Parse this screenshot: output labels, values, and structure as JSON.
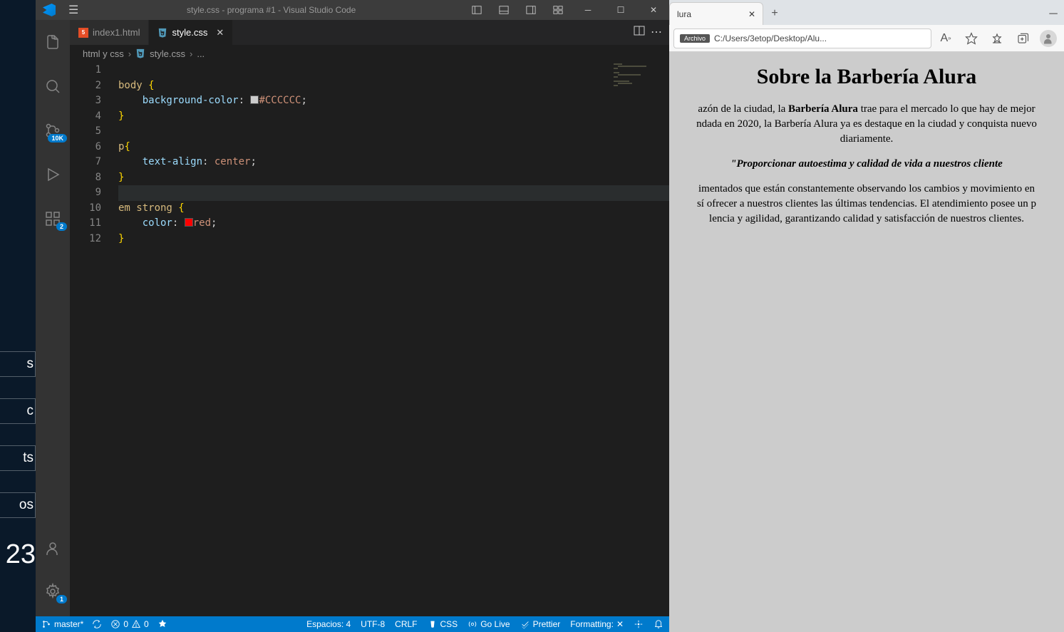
{
  "desktop": {
    "folders": [
      "s",
      "c",
      "ts",
      "os"
    ],
    "clock": "23"
  },
  "vscode": {
    "title": "style.css - programa #1 - Visual Studio Code",
    "tabs": [
      {
        "name": "index1.html",
        "icon": "html"
      },
      {
        "name": "style.css",
        "icon": "css",
        "active": true
      }
    ],
    "breadcrumb": {
      "folder": "html y css",
      "file": "style.css",
      "more": "..."
    },
    "activityBadges": {
      "scm": "10K",
      "extensions": "2",
      "settings": "1"
    },
    "code": {
      "lineCount": 12,
      "lines": [
        {
          "indent": "",
          "parts": [
            {
              "t": "body ",
              "c": "tok-selector"
            },
            {
              "t": "{",
              "c": "tok-brace"
            }
          ]
        },
        {
          "indent": "    ",
          "parts": [
            {
              "t": "background-color",
              "c": "tok-property"
            },
            {
              "t": ": ",
              "c": "tok-colon"
            },
            {
              "swatch": "#cccccc"
            },
            {
              "t": "#CCCCCC",
              "c": "tok-value"
            },
            {
              "t": ";",
              "c": "tok-semi"
            }
          ]
        },
        {
          "indent": "",
          "parts": [
            {
              "t": "}",
              "c": "tok-brace"
            }
          ]
        },
        {
          "indent": "",
          "parts": []
        },
        {
          "indent": "",
          "parts": [
            {
              "t": "p",
              "c": "tok-selector"
            },
            {
              "t": "{",
              "c": "tok-brace"
            }
          ]
        },
        {
          "indent": "    ",
          "parts": [
            {
              "t": "text-align",
              "c": "tok-property"
            },
            {
              "t": ": ",
              "c": "tok-colon"
            },
            {
              "t": "center",
              "c": "tok-value"
            },
            {
              "t": ";",
              "c": "tok-semi"
            }
          ]
        },
        {
          "indent": "",
          "parts": [
            {
              "t": "}",
              "c": "tok-brace"
            }
          ]
        },
        {
          "indent": "",
          "parts": [],
          "current": true
        },
        {
          "indent": "",
          "parts": [
            {
              "t": "em strong ",
              "c": "tok-selector"
            },
            {
              "t": "{",
              "c": "tok-brace"
            }
          ]
        },
        {
          "indent": "    ",
          "parts": [
            {
              "t": "color",
              "c": "tok-property"
            },
            {
              "t": ": ",
              "c": "tok-colon"
            },
            {
              "swatch": "#ff0000"
            },
            {
              "t": "red",
              "c": "tok-value"
            },
            {
              "t": ";",
              "c": "tok-semi"
            }
          ]
        },
        {
          "indent": "",
          "parts": [
            {
              "t": "}",
              "c": "tok-brace"
            }
          ]
        }
      ]
    },
    "statusbar": {
      "branch": "master*",
      "errors": "0",
      "warnings": "0",
      "spaces": "Espacios: 4",
      "encoding": "UTF-8",
      "eol": "CRLF",
      "lang": "CSS",
      "golive": "Go Live",
      "prettier": "Prettier",
      "formatting": "Formatting:"
    }
  },
  "browser": {
    "tabTitle": "lura",
    "address": "C:/Users/3etop/Desktop/Alu...",
    "addressLabel": "Archivo",
    "content": {
      "h1": "Sobre la Barbería Alura",
      "p1_before": "azón de la ciudad, la ",
      "p1_bold": "Barbería Alura",
      "p1_after": " trae para el mercado lo que hay de mejor",
      "p2": "ndada en 2020, la Barbería Alura ya es destaque en la ciudad y conquista nuevo",
      "p3": "diariamente.",
      "quote": "\"Proporcionar autoestima y calidad de vida a nuestros cliente",
      "p4": "imentados que están constantemente observando los cambios y movimiento en",
      "p5": "sí ofrecer a nuestros clientes las últimas tendencias. El atendimiento posee un p",
      "p6": "lencia y agilidad, garantizando calidad y satisfacción de nuestros clientes."
    }
  }
}
